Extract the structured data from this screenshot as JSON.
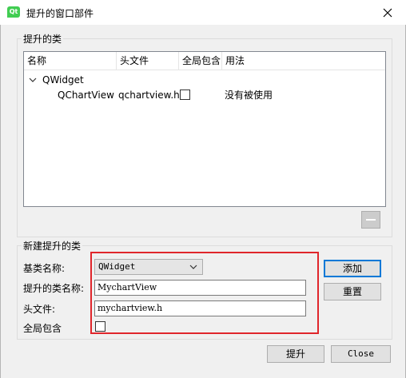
{
  "window": {
    "title": "提升的窗口部件",
    "icon_text": "Qt"
  },
  "promoted_group": {
    "title": "提升的类",
    "columns": [
      "名称",
      "头文件",
      "全局包含",
      "用法"
    ],
    "tree": {
      "parent": {
        "expanded": true,
        "label": "QWidget"
      },
      "child": {
        "name": "QChartView",
        "header": "qchartview.h",
        "global_include": false,
        "usage": "没有被使用"
      }
    }
  },
  "new_group": {
    "title": "新建提升的类",
    "base_class_label": "基类名称:",
    "base_class_value": "QWidget",
    "class_name_label": "提升的类名称:",
    "class_name_value": "MychartView",
    "header_label": "头文件:",
    "header_value": "mychartview.h",
    "global_include_label": "全局包含",
    "global_include_checked": false
  },
  "buttons": {
    "add": "添加",
    "reset": "重置",
    "promote": "提升",
    "close": "Close"
  },
  "colors": {
    "highlight_box": "#e0262b",
    "default_button_border": "#0078d7"
  }
}
